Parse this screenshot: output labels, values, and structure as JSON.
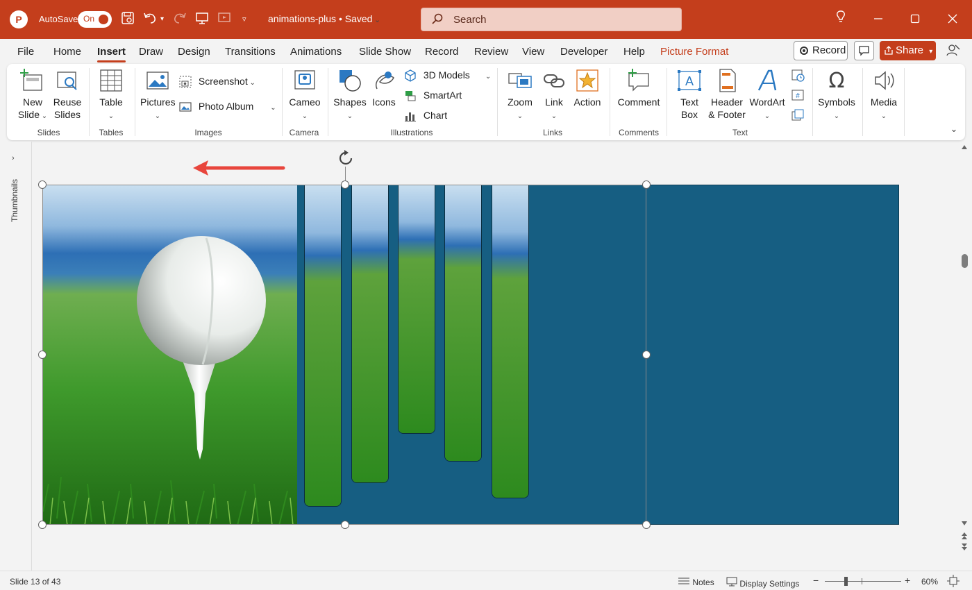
{
  "titlebar": {
    "autosave_label": "AutoSave",
    "autosave_state": "On",
    "document_title": "animations-plus • Saved",
    "search_placeholder": "Search"
  },
  "tabs": [
    {
      "label": "File"
    },
    {
      "label": "Home"
    },
    {
      "label": "Insert",
      "active": true
    },
    {
      "label": "Draw"
    },
    {
      "label": "Design"
    },
    {
      "label": "Transitions"
    },
    {
      "label": "Animations"
    },
    {
      "label": "Slide Show"
    },
    {
      "label": "Record"
    },
    {
      "label": "Review"
    },
    {
      "label": "View"
    },
    {
      "label": "Developer"
    },
    {
      "label": "Help"
    },
    {
      "label": "Picture Format",
      "contextual": true
    }
  ],
  "header_actions": {
    "record_label": "Record",
    "share_label": "Share"
  },
  "ribbon": {
    "slides": {
      "new_slide_1": "New",
      "new_slide_2": "Slide",
      "reuse_1": "Reuse",
      "reuse_2": "Slides",
      "group": "Slides"
    },
    "tables": {
      "table": "Table",
      "group": "Tables"
    },
    "images": {
      "pictures": "Pictures",
      "screenshot": "Screenshot",
      "photo_album": "Photo Album",
      "group": "Images"
    },
    "camera": {
      "cameo": "Cameo",
      "group": "Camera"
    },
    "illustrations": {
      "shapes": "Shapes",
      "icons": "Icons",
      "models3d": "3D Models",
      "smartart": "SmartArt",
      "chart": "Chart",
      "group": "Illustrations"
    },
    "links": {
      "zoom": "Zoom",
      "link": "Link",
      "action": "Action",
      "group": "Links"
    },
    "comments": {
      "comment": "Comment",
      "group": "Comments"
    },
    "text": {
      "textbox_1": "Text",
      "textbox_2": "Box",
      "header_1": "Header",
      "header_2": "& Footer",
      "wordart": "WordArt",
      "group": "Text"
    },
    "symbols": {
      "label": "Symbols"
    },
    "media": {
      "label": "Media"
    }
  },
  "workspace": {
    "thumbnails_label": "Thumbnails"
  },
  "statusbar": {
    "slide_info": "Slide 13 of 43",
    "notes": "Notes",
    "display_settings": "Display Settings",
    "zoom_minus": "−",
    "zoom_plus": "+",
    "zoom_level": "60%"
  },
  "colors": {
    "accent": "#c43e1c",
    "slide_background": "#165e82"
  }
}
